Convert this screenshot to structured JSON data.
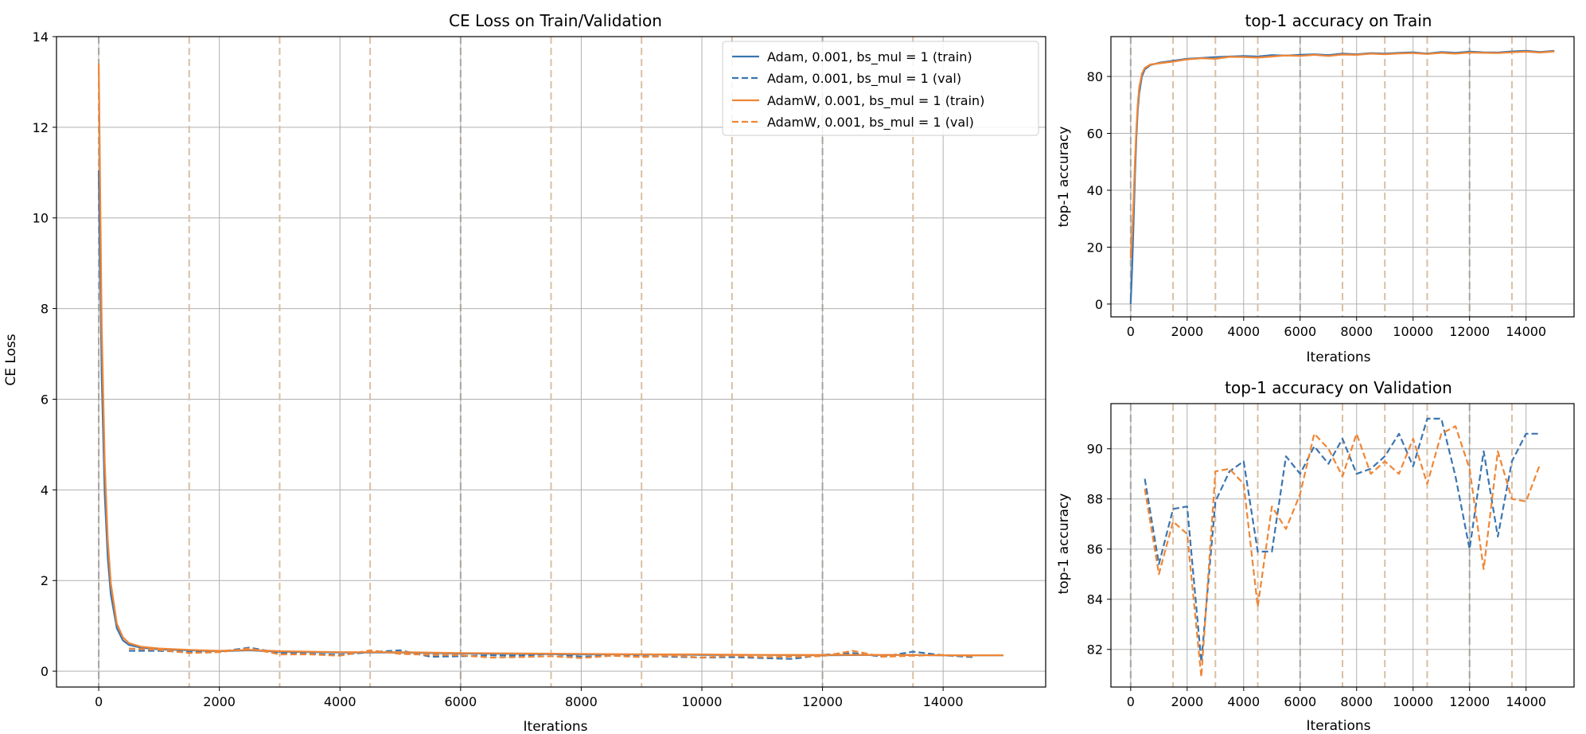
{
  "figure": {
    "colors": {
      "adam": "#3b75af",
      "adamw": "#ef8636",
      "grid": "#b0b0b0",
      "dashed_vline": "#d9bfa3",
      "solid_vline": "#a9a39c"
    },
    "vlines_dashed_x": [
      1500,
      3000,
      4500,
      7500,
      9000,
      10500,
      13500
    ],
    "vlines_solid_x": [
      0,
      6000,
      12000
    ]
  },
  "chart_data": [
    {
      "type": "line",
      "title": "CE Loss on Train/Validation",
      "xlabel": "Iterations",
      "ylabel": "CE Loss",
      "xlim": [
        -700,
        15700
      ],
      "ylim": [
        -0.35,
        14.0
      ],
      "xticks": [
        0,
        2000,
        4000,
        6000,
        8000,
        10000,
        12000,
        14000
      ],
      "yticks": [
        0,
        2,
        4,
        6,
        8,
        10,
        12,
        14
      ],
      "grid": true,
      "legend": "top-right",
      "series": [
        {
          "name": "Adam, 0.001, bs_mul = 1 (train)",
          "style": "solid",
          "color": "adam",
          "x": [
            0,
            50,
            100,
            150,
            200,
            300,
            400,
            500,
            700,
            1000,
            1500,
            2000,
            2500,
            3000,
            4000,
            5000,
            6000,
            7000,
            8000,
            9000,
            10000,
            11000,
            12000,
            13000,
            14000,
            15000
          ],
          "y": [
            11.05,
            6.5,
            3.9,
            2.5,
            1.7,
            0.95,
            0.68,
            0.58,
            0.52,
            0.48,
            0.46,
            0.44,
            0.46,
            0.43,
            0.41,
            0.41,
            0.39,
            0.38,
            0.37,
            0.37,
            0.36,
            0.36,
            0.35,
            0.36,
            0.35,
            0.35
          ]
        },
        {
          "name": "Adam, 0.001, bs_mul = 1 (val)",
          "style": "dashed",
          "color": "adam",
          "x": [
            500,
            1000,
            1500,
            2000,
            2500,
            3000,
            3500,
            4000,
            4500,
            5000,
            5500,
            6000,
            6500,
            7000,
            7500,
            8000,
            8500,
            9000,
            9500,
            10000,
            10500,
            11000,
            11500,
            12000,
            12500,
            13000,
            13500,
            14000,
            14500
          ],
          "y": [
            0.45,
            0.45,
            0.42,
            0.43,
            0.52,
            0.4,
            0.38,
            0.36,
            0.42,
            0.46,
            0.32,
            0.33,
            0.35,
            0.34,
            0.38,
            0.32,
            0.34,
            0.33,
            0.32,
            0.3,
            0.31,
            0.29,
            0.27,
            0.36,
            0.4,
            0.32,
            0.43,
            0.35,
            0.31
          ]
        },
        {
          "name": "AdamW, 0.001, bs_mul = 1 (train)",
          "style": "solid",
          "color": "adamw",
          "x": [
            0,
            50,
            100,
            150,
            200,
            300,
            400,
            500,
            700,
            1000,
            1500,
            2000,
            2500,
            3000,
            4000,
            5000,
            6000,
            7000,
            8000,
            9000,
            10000,
            11000,
            12000,
            13000,
            14000,
            15000
          ],
          "y": [
            13.4,
            7.6,
            4.6,
            2.9,
            1.95,
            1.05,
            0.75,
            0.62,
            0.54,
            0.5,
            0.47,
            0.45,
            0.47,
            0.44,
            0.42,
            0.42,
            0.4,
            0.39,
            0.38,
            0.37,
            0.37,
            0.36,
            0.36,
            0.36,
            0.35,
            0.35
          ]
        },
        {
          "name": "AdamW, 0.001, bs_mul = 1 (val)",
          "style": "dashed",
          "color": "adamw",
          "x": [
            500,
            1000,
            1500,
            2000,
            2500,
            3000,
            3500,
            4000,
            4500,
            5000,
            5500,
            6000,
            6500,
            7000,
            7500,
            8000,
            8500,
            9000,
            9500,
            10000,
            10500,
            11000,
            11500,
            12000,
            12500,
            13000,
            13500,
            14000,
            14500
          ],
          "y": [
            0.5,
            0.47,
            0.4,
            0.42,
            0.5,
            0.37,
            0.37,
            0.34,
            0.46,
            0.38,
            0.36,
            0.35,
            0.3,
            0.31,
            0.33,
            0.29,
            0.34,
            0.31,
            0.34,
            0.3,
            0.34,
            0.31,
            0.32,
            0.33,
            0.45,
            0.32,
            0.34,
            0.36,
            0.33
          ]
        }
      ]
    },
    {
      "type": "line",
      "title": "top-1 accuracy on Train",
      "xlabel": "Iterations",
      "ylabel": "top-1 accuracy",
      "xlim": [
        -700,
        15700
      ],
      "ylim": [
        -4.5,
        94.0
      ],
      "xticks": [
        0,
        2000,
        4000,
        6000,
        8000,
        10000,
        12000,
        14000
      ],
      "yticks": [
        0,
        20,
        40,
        60,
        80
      ],
      "grid": true,
      "series": [
        {
          "style": "solid",
          "color": "adam",
          "x": [
            0,
            50,
            100,
            150,
            200,
            250,
            300,
            400,
            500,
            700,
            1000,
            1500,
            2000,
            2500,
            3000,
            3500,
            4000,
            4500,
            5000,
            5500,
            6000,
            6500,
            7000,
            7500,
            8000,
            8500,
            9000,
            9500,
            10000,
            10500,
            11000,
            11500,
            12000,
            12500,
            13000,
            13500,
            14000,
            14500,
            15000
          ],
          "y": [
            0.0,
            12.0,
            28.0,
            45.0,
            58.0,
            68.0,
            74.0,
            80.0,
            82.5,
            84.0,
            84.8,
            85.5,
            86.2,
            86.5,
            86.8,
            87.0,
            87.2,
            87.0,
            87.5,
            87.3,
            87.6,
            87.8,
            87.5,
            88.0,
            87.8,
            88.2,
            88.0,
            88.3,
            88.5,
            88.0,
            88.6,
            88.3,
            88.7,
            88.5,
            88.4,
            88.8,
            89.0,
            88.6,
            89.0
          ]
        },
        {
          "style": "solid",
          "color": "adamw",
          "x": [
            0,
            50,
            100,
            150,
            200,
            250,
            300,
            400,
            500,
            700,
            1000,
            1500,
            2000,
            2500,
            3000,
            3500,
            4000,
            4500,
            5000,
            5500,
            6000,
            6500,
            7000,
            7500,
            8000,
            8500,
            9000,
            9500,
            10000,
            10500,
            11000,
            11500,
            12000,
            12500,
            13000,
            13500,
            14000,
            14500,
            15000
          ],
          "y": [
            16.0,
            24.0,
            36.0,
            50.0,
            61.0,
            70.0,
            76.0,
            81.0,
            83.0,
            84.2,
            84.6,
            85.2,
            86.0,
            86.4,
            86.2,
            86.9,
            86.8,
            86.6,
            87.0,
            87.4,
            87.2,
            87.6,
            87.2,
            87.7,
            87.6,
            88.0,
            87.8,
            88.1,
            88.2,
            87.9,
            88.3,
            88.0,
            88.4,
            88.3,
            88.2,
            88.5,
            88.7,
            88.4,
            88.8
          ]
        }
      ]
    },
    {
      "type": "line",
      "title": "top-1 accuracy on Validation",
      "xlabel": "Iterations",
      "ylabel": "top-1 accuracy",
      "xlim": [
        -700,
        15700
      ],
      "ylim": [
        80.5,
        91.8
      ],
      "xticks": [
        0,
        2000,
        4000,
        6000,
        8000,
        10000,
        12000,
        14000
      ],
      "yticks": [
        82,
        84,
        86,
        88,
        90
      ],
      "grid": true,
      "series": [
        {
          "style": "dashed",
          "color": "adam",
          "x": [
            500,
            1000,
            1500,
            2000,
            2500,
            3000,
            3500,
            4000,
            4500,
            5000,
            5500,
            6000,
            6500,
            7000,
            7500,
            8000,
            8500,
            9000,
            9500,
            10000,
            10500,
            11000,
            11500,
            12000,
            12500,
            13000,
            13500,
            14000,
            14500
          ],
          "y": [
            88.8,
            85.4,
            87.6,
            87.7,
            81.5,
            87.9,
            89.1,
            89.5,
            85.9,
            85.9,
            89.7,
            89.0,
            90.1,
            89.4,
            90.4,
            89.0,
            89.2,
            89.7,
            90.6,
            89.3,
            91.2,
            91.2,
            88.9,
            86.0,
            89.9,
            86.5,
            89.5,
            90.6,
            90.6
          ]
        },
        {
          "style": "dashed",
          "color": "adamw",
          "x": [
            500,
            1000,
            1500,
            2000,
            2500,
            3000,
            3500,
            4000,
            4500,
            5000,
            5500,
            6000,
            6500,
            7000,
            7500,
            8000,
            8500,
            9000,
            9500,
            10000,
            10500,
            11000,
            11500,
            12000,
            12500,
            13000,
            13500,
            14000,
            14500
          ],
          "y": [
            88.4,
            85.0,
            87.1,
            86.6,
            80.9,
            89.1,
            89.2,
            88.6,
            83.7,
            87.7,
            86.8,
            88.2,
            90.6,
            90.0,
            88.9,
            90.6,
            89.0,
            89.5,
            89.0,
            90.4,
            88.6,
            90.6,
            90.9,
            89.2,
            85.2,
            89.9,
            88.0,
            87.9,
            89.4
          ]
        }
      ]
    }
  ]
}
